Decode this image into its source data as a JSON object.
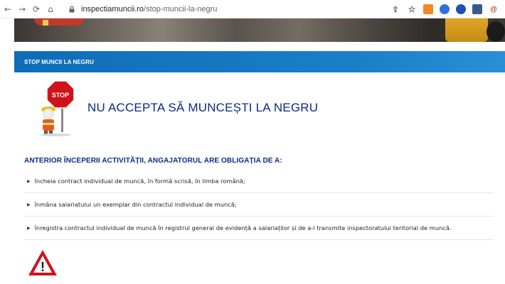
{
  "browser": {
    "url_domain": "inspectiamuncii.ro",
    "url_path": "/stop-muncii-la-negru"
  },
  "page": {
    "section_bar_label": "STOP MUNCII LA NEGRU",
    "stop_sign_text": "STOP",
    "headline": "NU ACCEPTA SĂ MUNCEȘTI LA NEGRU",
    "obligations_title": "ANTERIOR ÎNCEPERII ACTIVITĂȚII, ANGAJATORUL ARE OBLIGAȚIA DE A:",
    "obligations": [
      "încheia contract individual de muncă, în formă scrisă, în limba română;",
      "înmâna salariatului un exemplar din contractul individual de muncă;",
      "înregistra contractul individual de muncă în registrul general de evidență a salariaților și de a-l transmite inspectoratului teritorial de muncă."
    ],
    "warning_symbol": "!"
  },
  "colors": {
    "brand_blue": "#1a7fc9",
    "heading_navy": "#0a2a8a",
    "stop_red": "#d0121b"
  }
}
